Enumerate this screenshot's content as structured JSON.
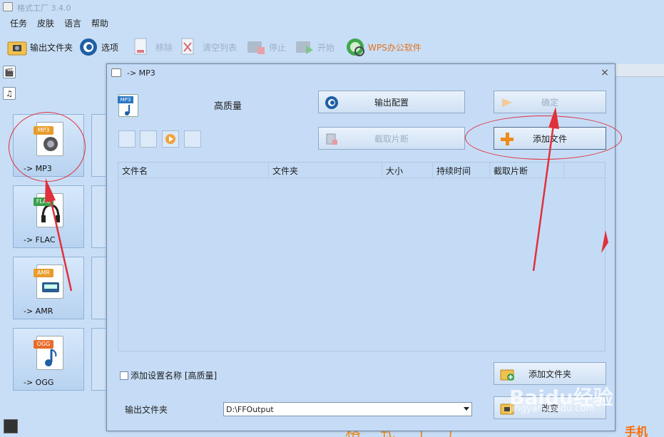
{
  "window": {
    "title": "格式工厂 3.4.0"
  },
  "menu": [
    "任务",
    "皮肤",
    "语言",
    "帮助"
  ],
  "toolbar": {
    "output_folder": "输出文件夹",
    "options": "选项",
    "remove": "移除",
    "clear_list": "清空列表",
    "stop": "停止",
    "start": "开始",
    "wps": "WPS办公软件"
  },
  "format_tiles": [
    {
      "label": "-> MP3",
      "tag": "MP3",
      "tag_color": "#e89b2a"
    },
    {
      "label": "-> FLAC",
      "tag": "FLAC",
      "tag_color": "#3aa048"
    },
    {
      "label": "-> AMR",
      "tag": "AMR",
      "tag_color": "#e89b2a"
    },
    {
      "label": "-> OGG",
      "tag": "OGG",
      "tag_color": "#e86b2a"
    }
  ],
  "dialog": {
    "title": "-> MP3",
    "close_glyph": "×",
    "quality": "高质量",
    "quality_icon_tag": "MP3",
    "output_config": "输出配置",
    "ok": "确定",
    "clip": "截取片断",
    "add_file": "添加文件",
    "table_headers": [
      "文件名",
      "文件夹",
      "大小",
      "持续时间",
      "截取片断"
    ],
    "checkbox_label": "添加设置名称 [高质量]",
    "add_folder": "添加文件夹",
    "output_folder_label": "输出文件夹",
    "output_folder_value": "D:\\FFOutput",
    "change": "改变"
  },
  "banner": {
    "text": "格式工厂",
    "phone": "手机"
  },
  "watermark": {
    "line1": "Baidu经验",
    "line2": "jingyan.baidu.com"
  },
  "annotation_color": "#e0303b"
}
